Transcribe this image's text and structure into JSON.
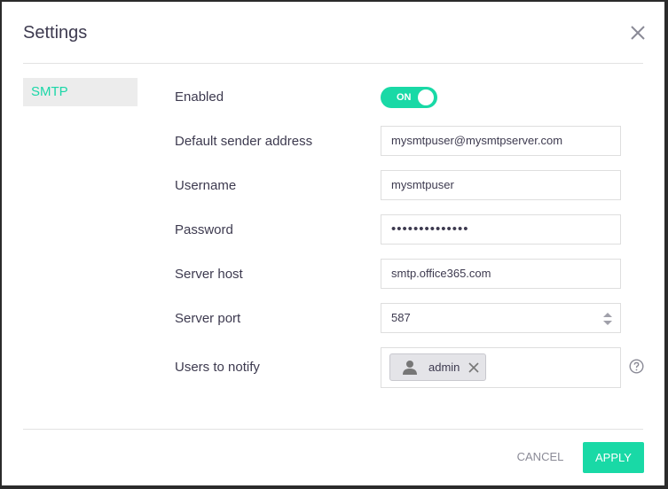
{
  "dialog": {
    "title": "Settings",
    "close_icon": "close-icon"
  },
  "sidebar": {
    "items": [
      {
        "label": "SMTP",
        "active": true
      }
    ]
  },
  "form": {
    "enabled": {
      "label": "Enabled",
      "toggle_text": "ON",
      "value": true
    },
    "sender": {
      "label": "Default sender address",
      "value": "mysmtpuser@mysmtpserver.com"
    },
    "username": {
      "label": "Username",
      "value": "mysmtpuser"
    },
    "password": {
      "label": "Password",
      "value": "••••••••••••••"
    },
    "host": {
      "label": "Server host",
      "value": "smtp.office365.com"
    },
    "port": {
      "label": "Server port",
      "value": "587"
    },
    "notify": {
      "label": "Users to notify",
      "users": [
        "admin"
      ],
      "help_icon": "help-circle-icon"
    }
  },
  "footer": {
    "cancel_label": "CANCEL",
    "apply_label": "APPLY"
  },
  "colors": {
    "accent": "#19d9a6",
    "text": "#3d3a4f",
    "muted": "#8a8a96"
  }
}
